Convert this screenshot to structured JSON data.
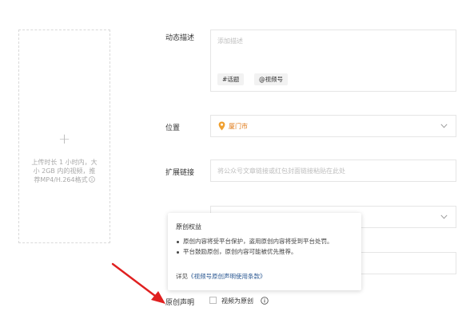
{
  "upload": {
    "plus": "+",
    "hint": "上传时长 1 小时内，大\n小 2GB 内的视频，推\n荐MP4/H.264格式"
  },
  "description": {
    "label": "动态描述",
    "placeholder": "添加描述",
    "tags": [
      "#话题",
      "@视频号"
    ]
  },
  "location": {
    "label": "位置",
    "value": "厦门市"
  },
  "link": {
    "label": "扩展链接",
    "placeholder": "将公众号文章链接或红包封面链接粘贴在此处"
  },
  "popover": {
    "title": "原创权益",
    "items": [
      "原创内容将受平台保护，盗用原创内容将受到平台处罚。",
      "平台鼓励原创，原创内容可能被优先推荐。"
    ],
    "detail_prefix": "详见",
    "detail_link": "《视频号原创声明使用条款》"
  },
  "original": {
    "label": "原创声明",
    "checkbox_label": "视频为原创"
  },
  "colors": {
    "accent_orange": "#e07b1a",
    "link_blue": "#2d5a93",
    "arrow_red": "#e02020"
  }
}
